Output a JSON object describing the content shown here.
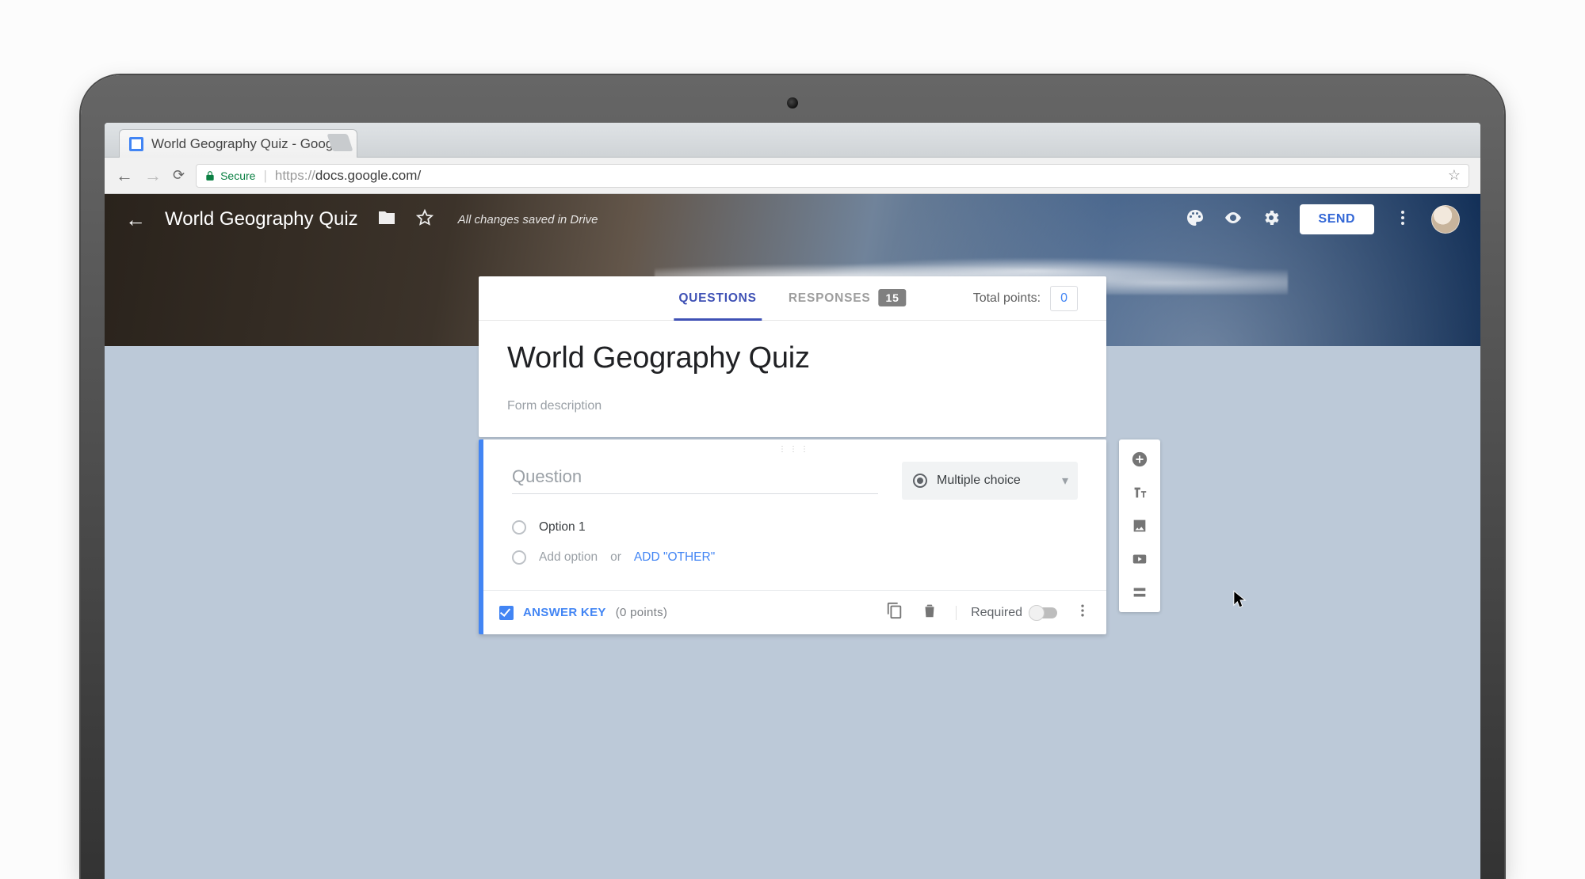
{
  "browser": {
    "tab_title": "World Geography Quiz - Goog",
    "secure_label": "Secure",
    "url_scheme": "https://",
    "url_host": "docs.google.com",
    "url_path": "/"
  },
  "header": {
    "title": "World Geography Quiz",
    "save_state": "All changes saved in Drive",
    "send_label": "SEND"
  },
  "tabs": {
    "questions": "QUESTIONS",
    "responses": "RESPONSES",
    "responses_count": "15",
    "points_label": "Total points:",
    "points_value": "0"
  },
  "form": {
    "title": "World Geography Quiz",
    "description_placeholder": "Form description"
  },
  "question": {
    "placeholder": "Question",
    "type_label": "Multiple choice",
    "option1": "Option 1",
    "add_option": "Add option",
    "or": "or",
    "add_other": "ADD \"OTHER\"",
    "answer_key": "ANSWER KEY",
    "points_display": "(0 points)",
    "required_label": "Required"
  }
}
